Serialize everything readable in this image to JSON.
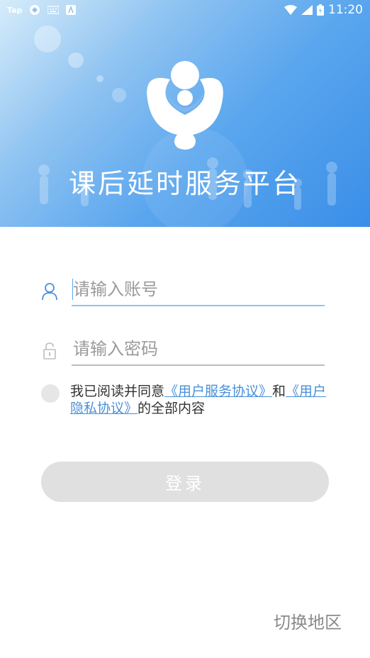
{
  "status_bar": {
    "app_label": "Tap",
    "time": "11:20"
  },
  "header": {
    "title": "课后延时服务平台",
    "logo_icon": "family-logo-icon"
  },
  "form": {
    "account": {
      "placeholder": "请输入账号",
      "icon": "user-icon"
    },
    "password": {
      "placeholder": "请输入密码",
      "icon": "lock-icon"
    }
  },
  "agreement": {
    "prefix": "我已阅读并同意",
    "link_service": "《用户服务协议》",
    "conjunction": "和",
    "link_privacy": "《用户隐私协议》",
    "suffix": "的全部内容"
  },
  "login_button": "登录",
  "switch_region": "切换地区",
  "colors": {
    "accent": "#4a90d9",
    "banner": "#5aa6ee",
    "button_disabled": "#e0e0e0"
  }
}
